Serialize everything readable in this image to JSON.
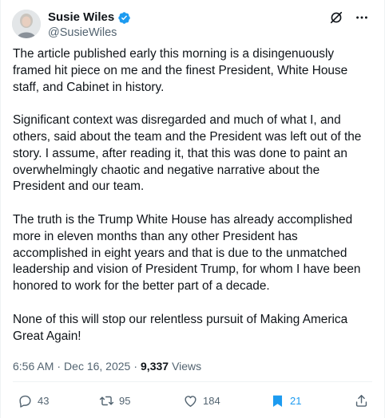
{
  "post": {
    "display_name": "Susie Wiles",
    "handle": "@SusieWiles",
    "paragraphs": [
      "The article published early this morning is a disingenuously framed hit piece on me and the finest President, White House staff, and Cabinet in history.",
      "Significant context was disregarded and much of what I, and others, said about the team and the President was left out of the story. I assume, after reading it, that this was done to paint an overwhelmingly chaotic and negative narrative about the President and our team.",
      "The truth is the Trump White House has already accomplished more in eleven months than any other President has accomplished in eight years and that is due to the unmatched leadership and vision of President Trump, for whom I have been honored to work for the better part of a decade.",
      "None of this will stop our relentless pursuit of Making America Great Again!"
    ],
    "time": "6:56 AM",
    "separator": "·",
    "date": "Dec 16, 2025",
    "views_count": "9,337",
    "views_label": "Views"
  },
  "actions": {
    "replies": "43",
    "reposts": "95",
    "likes": "184",
    "bookmarks": "21"
  },
  "colors": {
    "accent": "#1d9bf0",
    "text": "#0f1419",
    "muted": "#536471"
  },
  "icons": [
    "verified-badge-icon",
    "grok-icon",
    "more-icon",
    "reply-icon",
    "repost-icon",
    "like-icon",
    "bookmark-icon",
    "share-icon"
  ]
}
